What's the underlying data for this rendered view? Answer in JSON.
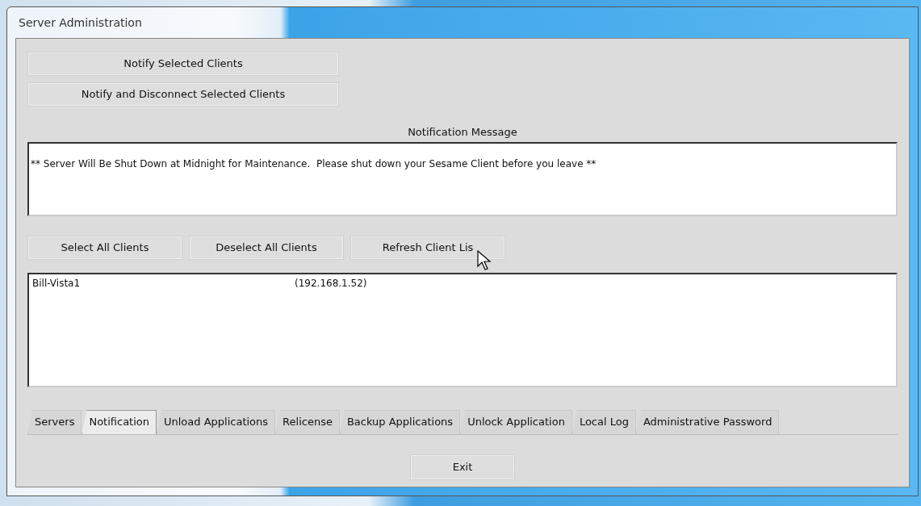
{
  "window": {
    "title": "Server Administration"
  },
  "notify_buttons": [
    "Notify Selected Clients",
    "Notify and Disconnect Selected Clients"
  ],
  "message": {
    "label": "Notification Message",
    "value": "** Server Will Be Shut Down at Midnight for Maintenance.  Please shut down your Sesame Client before you leave **"
  },
  "client_buttons": [
    "Select All Clients",
    "Deselect All Clients",
    "Refresh Client Lis"
  ],
  "clients": [
    {
      "name": "Bill-Vista1",
      "address": "(192.168.1.52)"
    }
  ],
  "tabs": [
    {
      "label": "Servers",
      "selected": false
    },
    {
      "label": "Notification",
      "selected": true
    },
    {
      "label": "Unload Applications",
      "selected": false
    },
    {
      "label": "Relicense",
      "selected": false
    },
    {
      "label": "Backup Applications",
      "selected": false
    },
    {
      "label": "Unlock Application",
      "selected": false
    },
    {
      "label": "Local Log",
      "selected": false
    },
    {
      "label": "Administrative Password",
      "selected": false
    }
  ],
  "exit_button": "Exit"
}
